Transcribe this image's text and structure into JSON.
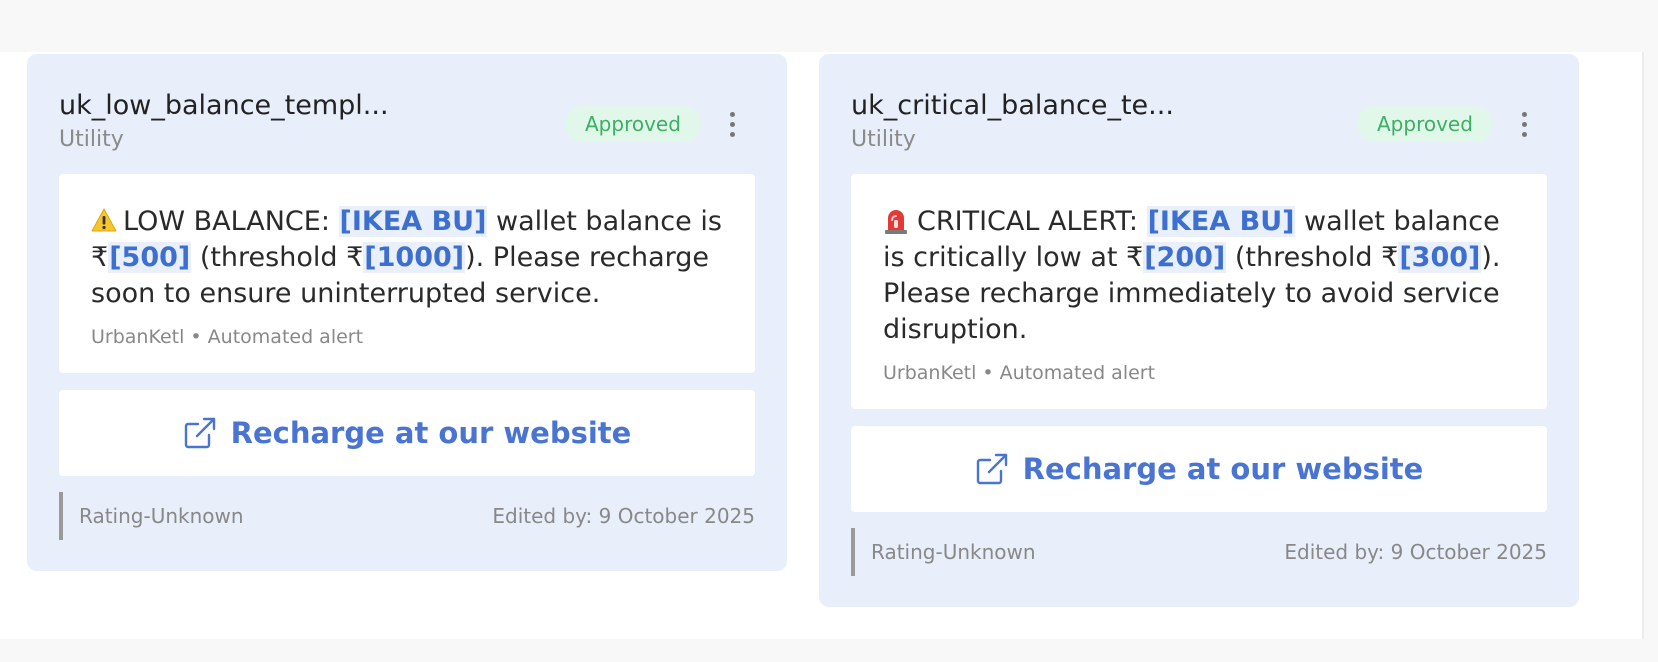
{
  "cards": [
    {
      "title": "uk_low_balance_templ...",
      "category": "Utility",
      "status": "Approved",
      "message": {
        "prefix": "LOW BALANCE: ",
        "var1": "[IKEA BU]",
        "text2": " wallet balance is ₹",
        "var2": "[500]",
        "text3": " (threshold ₹",
        "var3": "[1000]",
        "text4": "). Please recharge soon to ensure uninterrupted service."
      },
      "footer": "UrbanKetl • Automated alert",
      "cta_label": "Recharge at our website",
      "rating": "Rating-Unknown",
      "edited": "Edited by: 9 October 2025",
      "icons": {
        "emoji": "warning-icon",
        "cta": "external-link-icon",
        "menu": "more-vertical-icon"
      }
    },
    {
      "title": "uk_critical_balance_te...",
      "category": "Utility",
      "status": "Approved",
      "message": {
        "prefix": "CRITICAL ALERT: ",
        "var1": "[IKEA BU]",
        "text2": " wallet balance is critically low at ₹",
        "var2": "[200]",
        "text3": " (threshold ₹",
        "var3": "[300]",
        "text4": "). Please recharge immediately to avoid service disruption."
      },
      "footer": "UrbanKetl • Automated alert",
      "cta_label": "Recharge at our website",
      "rating": "Rating-Unknown",
      "edited": "Edited by: 9 October 2025",
      "icons": {
        "emoji": "siren-icon",
        "cta": "external-link-icon",
        "menu": "more-vertical-icon"
      }
    }
  ],
  "colors": {
    "card_bg": "#e8eefa",
    "accent": "#4a74d2",
    "status_bg": "#e1f7ea",
    "status_text": "#3cb062"
  }
}
